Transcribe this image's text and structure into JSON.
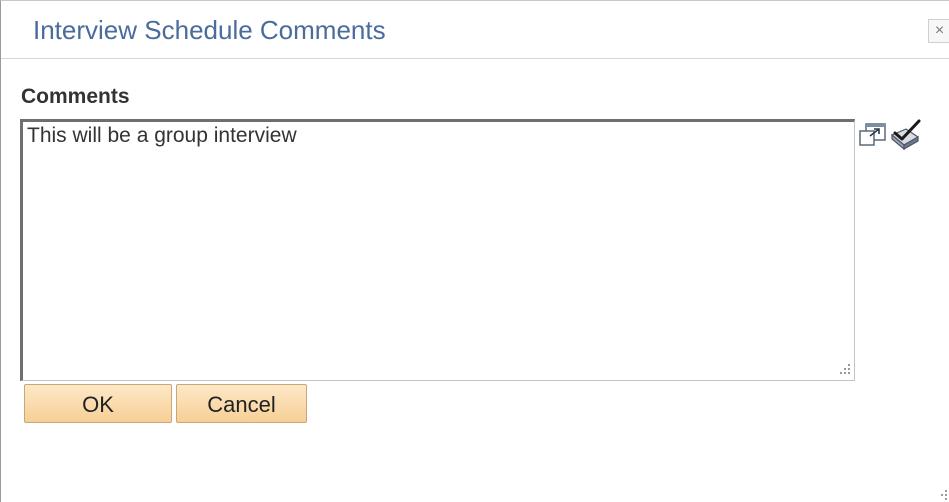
{
  "dialog": {
    "title": "Interview Schedule Comments",
    "close_symbol": "×"
  },
  "comments": {
    "label": "Comments",
    "value": "This will be a group interview",
    "icons": {
      "expand": "expand-window-icon",
      "spell_check": "spell-check-icon",
      "resize": "resize-grip-icon"
    }
  },
  "buttons": {
    "ok_label": "OK",
    "cancel_label": "Cancel"
  },
  "colors": {
    "title": "#4a6c9c",
    "button_top": "#fde8c7",
    "button_bottom": "#f7cf96",
    "button_border": "#c9a77a"
  }
}
